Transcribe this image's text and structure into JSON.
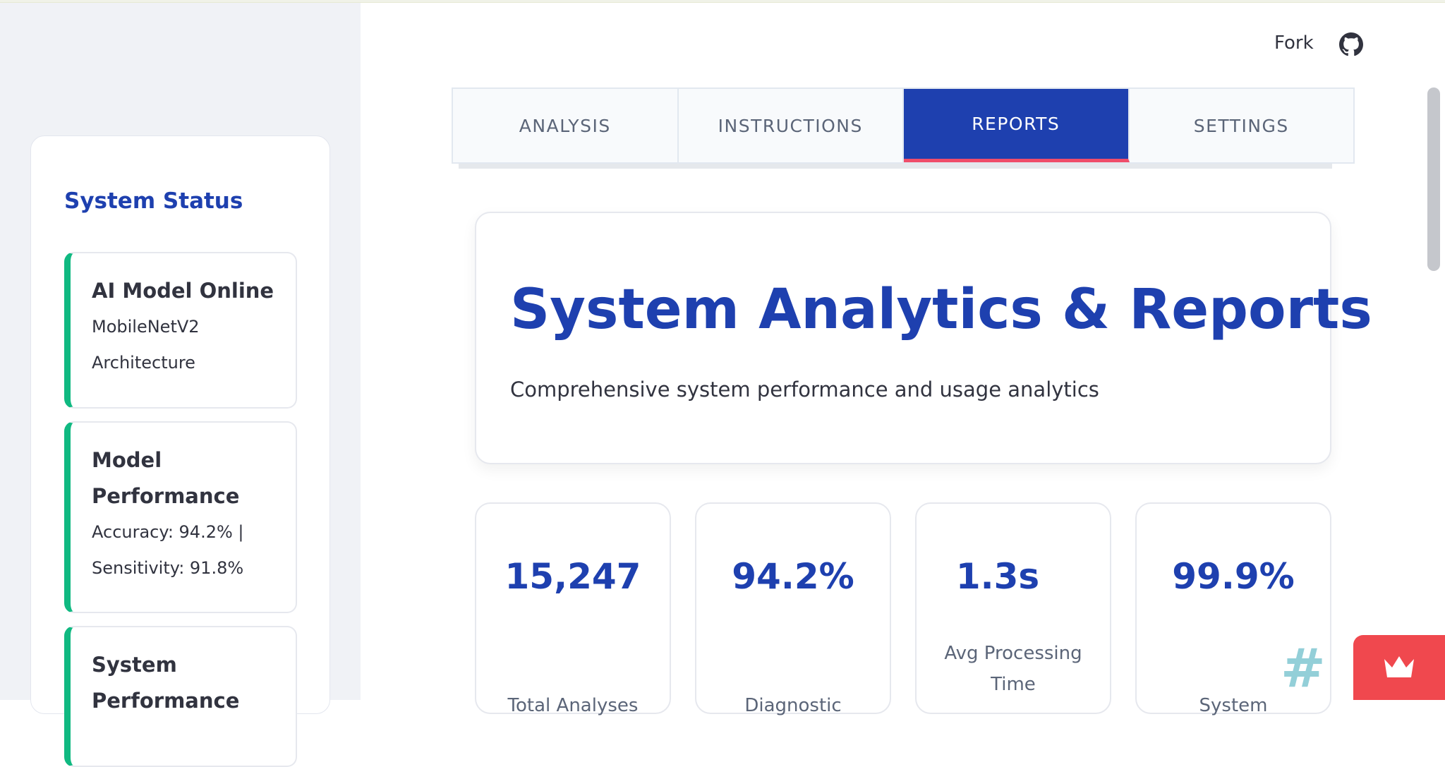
{
  "header": {
    "fork_label": "Fork",
    "github_icon": "github-icon"
  },
  "sidebar": {
    "status_title": "System Status",
    "items": [
      {
        "title": "AI Model Online",
        "lines": [
          "MobileNetV2",
          "Architecture"
        ]
      },
      {
        "title_lines": [
          "Model",
          "Performance"
        ],
        "lines": [
          "Accuracy: 94.2% |",
          "Sensitivity: 91.8%"
        ]
      },
      {
        "title_lines": [
          "System",
          "Performance"
        ],
        "lines": []
      }
    ],
    "accent_color": "#10b981"
  },
  "tabs": [
    {
      "label": "ANALYSIS",
      "active": false
    },
    {
      "label": "INSTRUCTIONS",
      "active": false
    },
    {
      "label": "REPORTS",
      "active": true
    },
    {
      "label": "SETTINGS",
      "active": false
    }
  ],
  "hero": {
    "title": "System Analytics & Reports",
    "subtitle": "Comprehensive system performance and usage analytics"
  },
  "metrics": [
    {
      "value": "15,247",
      "label": "Total Analyses"
    },
    {
      "value": "94.2%",
      "label": "Diagnostic"
    },
    {
      "value": "1.3s",
      "label": "Avg Processing Time"
    },
    {
      "value": "99.9%",
      "label": "System"
    }
  ],
  "widgets": {
    "hash_icon": "hash-icon",
    "crown_icon": "crown-icon"
  },
  "colors": {
    "primary": "#1e40af",
    "active_tab_underline": "#ef4d6a",
    "sidebar_bg": "#f0f2f6",
    "crown_button": "#f0484e"
  }
}
